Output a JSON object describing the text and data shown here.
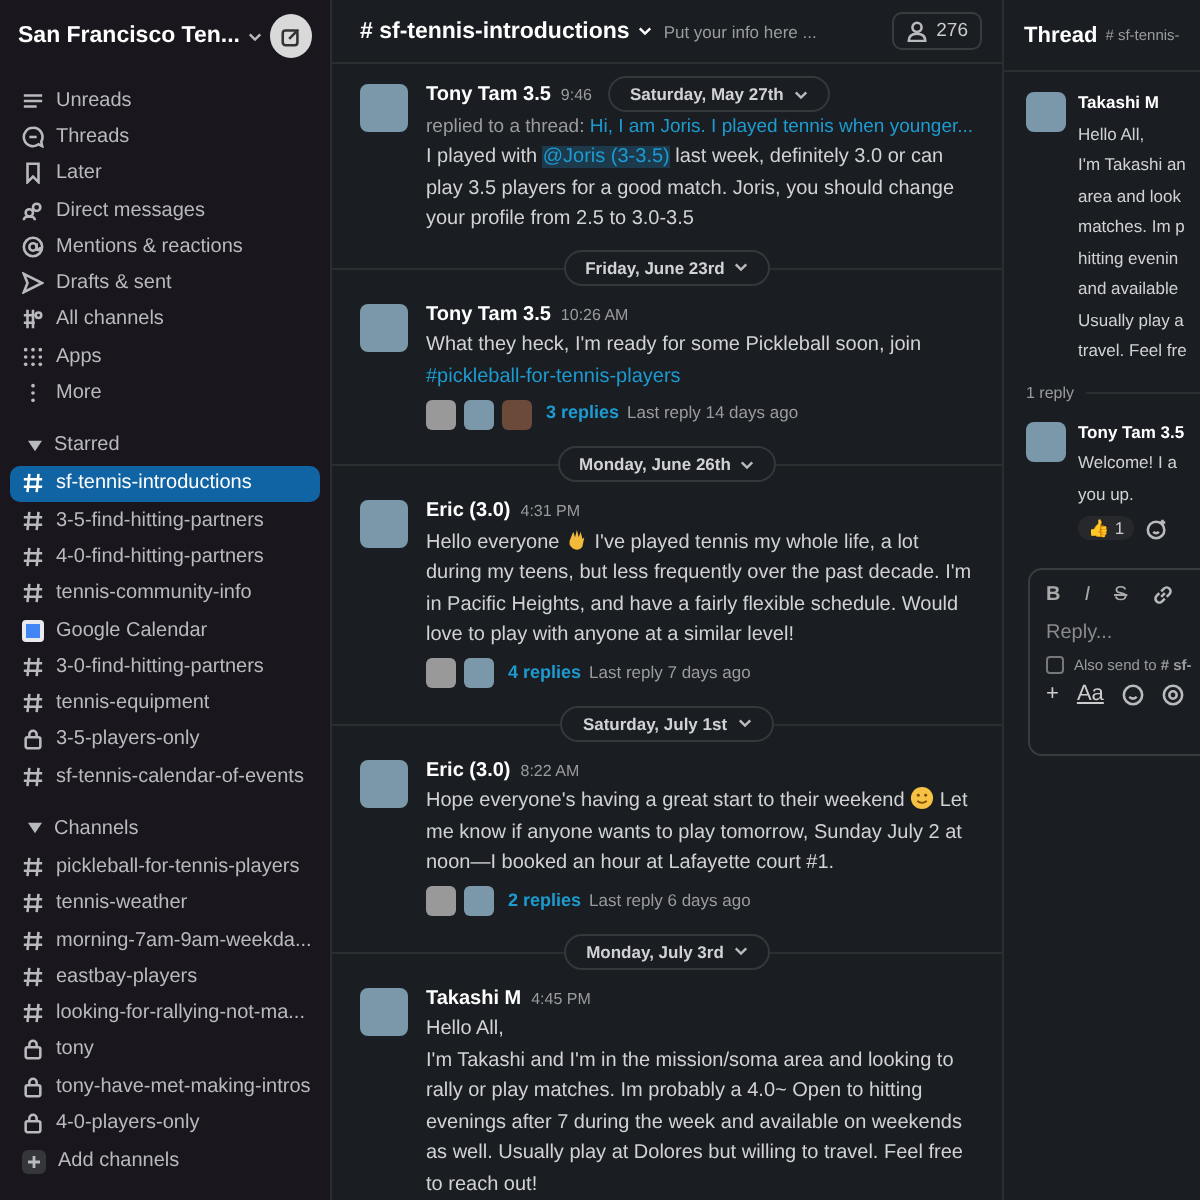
{
  "workspace": {
    "name": "San Francisco Ten..."
  },
  "nav": [
    {
      "label": "Unreads"
    },
    {
      "label": "Threads"
    },
    {
      "label": "Later"
    },
    {
      "label": "Direct messages"
    },
    {
      "label": "Mentions & reactions"
    },
    {
      "label": "Drafts & sent"
    },
    {
      "label": "All channels"
    },
    {
      "label": "Apps"
    },
    {
      "label": "More"
    }
  ],
  "sections": [
    {
      "title": "Starred",
      "expanded": true,
      "items": [
        {
          "kind": "public",
          "label": "sf-tennis-introductions",
          "selected": true
        },
        {
          "kind": "public",
          "label": "3-5-find-hitting-partners",
          "selected": false
        },
        {
          "kind": "public",
          "label": "4-0-find-hitting-partners",
          "selected": false
        },
        {
          "kind": "public",
          "label": "tennis-community-info",
          "selected": false
        },
        {
          "kind": "app",
          "label": "Google Calendar",
          "selected": false
        },
        {
          "kind": "public",
          "label": "3-0-find-hitting-partners",
          "selected": false
        },
        {
          "kind": "public",
          "label": "tennis-equipment",
          "selected": false
        },
        {
          "kind": "private",
          "label": "3-5-players-only",
          "selected": false
        },
        {
          "kind": "public",
          "label": "sf-tennis-calendar-of-events",
          "selected": false
        }
      ]
    },
    {
      "title": "Channels",
      "expanded": true,
      "items": [
        {
          "kind": "public",
          "label": "pickleball-for-tennis-players",
          "selected": false
        },
        {
          "kind": "public",
          "label": "tennis-weather",
          "selected": false
        },
        {
          "kind": "public",
          "label": "morning-7am-9am-weekda...",
          "selected": false
        },
        {
          "kind": "public",
          "label": "eastbay-players",
          "selected": false
        },
        {
          "kind": "public",
          "label": "looking-for-rallying-not-ma...",
          "selected": false
        },
        {
          "kind": "private",
          "label": "tony",
          "selected": false
        },
        {
          "kind": "private",
          "label": "tony-have-met-making-intros",
          "selected": false
        },
        {
          "kind": "private",
          "label": "4-0-players-only",
          "selected": false
        }
      ]
    }
  ],
  "add_channels": "Add channels",
  "channel": {
    "name": "# sf-tennis-introductions",
    "topic": "Put your info here ...",
    "members": "276"
  },
  "sticky_date": "Saturday, May 27th",
  "messages": [
    {
      "kind": "message",
      "author": "Tony Tam 3.5",
      "time": "9:46",
      "reply_context": [
        "replied to a thread: ",
        "Hi, I am Joris. I played tennis when younger..."
      ],
      "body": [
        {
          "kind": "text",
          "text": "I played with "
        },
        {
          "kind": "link",
          "text": "@Joris (3-3.5)"
        },
        {
          "kind": "text",
          "text": " last week, definitely 3.0 or can play 3.5 players for a good match. Joris, you should change your profile from 2.5 to 3.0-3.5"
        }
      ]
    },
    {
      "kind": "date",
      "label": "Friday, June 23rd"
    },
    {
      "kind": "message",
      "author": "Tony Tam 3.5",
      "time": "10:26 AM",
      "body": [
        {
          "kind": "text",
          "text": "What they heck, I'm ready for some Pickleball soon, join "
        },
        {
          "kind": "link",
          "text": "#pickleball-for-tennis-players"
        }
      ],
      "thread": {
        "replies": "3 replies",
        "last": "Last reply 14 days ago"
      }
    },
    {
      "kind": "date",
      "label": "Monday, June 26th"
    },
    {
      "kind": "message",
      "author": "Eric (3.0)",
      "time": "4:31 PM",
      "body": [
        {
          "kind": "text",
          "text": "Hello everyone "
        },
        {
          "kind": "wave"
        },
        {
          "kind": "text",
          "text": " I've played tennis my whole life, a lot during my teens, but less frequently over the past decade. I'm in Pacific Heights, and have a fairly flexible schedule. Would love to play with anyone at a similar level!"
        }
      ],
      "thread": {
        "replies": "4 replies",
        "last": "Last reply 7 days ago"
      }
    },
    {
      "kind": "date",
      "label": "Saturday, July 1st"
    },
    {
      "kind": "message",
      "author": "Eric (3.0)",
      "time": "8:22 AM",
      "body": [
        {
          "kind": "text",
          "text": "Hope everyone's having a great start to their weekend "
        },
        {
          "kind": "smile"
        },
        {
          "kind": "text",
          "text": " Let me know if anyone wants to play tomorrow, Sunday July 2 at noon—I booked an hour at Lafayette court #1."
        }
      ],
      "thread": {
        "replies": "2 replies",
        "last": "Last reply 6 days ago"
      }
    },
    {
      "kind": "date",
      "label": "Monday, July 3rd"
    },
    {
      "kind": "message",
      "author": "Takashi M",
      "time": "4:45 PM",
      "body": [
        {
          "kind": "text",
          "text": "Hello All,\nI'm Takashi and I'm in the mission/soma area and looking to rally or play matches. Im probably a 4.0~ Open to hitting evenings after 7 during the week and available on weekends as well. Usually play at Dolores but willing to travel. Feel free to reach out!"
        }
      ]
    }
  ],
  "thread_panel": {
    "title": "Thread",
    "channel": "# sf-tennis-",
    "root": {
      "author": "Takashi M",
      "lines": [
        "Hello All,",
        "I'm Takashi an",
        "area and look",
        "matches. Im p",
        "hitting evenin",
        "and available",
        "Usually play a",
        "travel. Feel fre"
      ]
    },
    "reply_count": "1 reply",
    "reply": {
      "author": "Tony Tam 3.5",
      "lines": [
        "Welcome! I a",
        "you up."
      ],
      "reactions": [
        {
          "emoji": "👍",
          "count": "1"
        }
      ]
    },
    "composer": {
      "format": [
        "B",
        "I",
        "S"
      ],
      "placeholder": "Reply...",
      "also_send": "Also send to",
      "also_channel": "# sf-",
      "also_checked": false,
      "tools": [
        "+",
        "Aa"
      ]
    }
  }
}
